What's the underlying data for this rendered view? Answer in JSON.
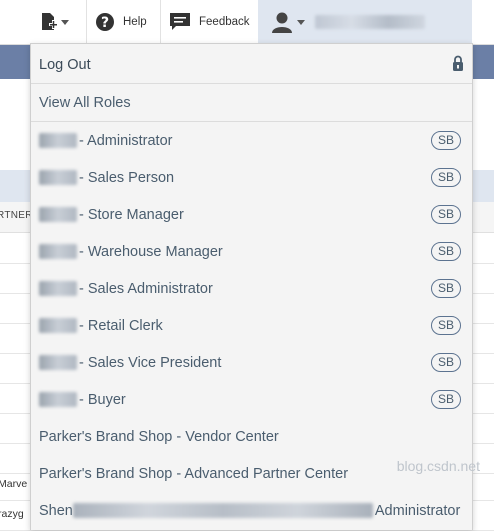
{
  "toolbar": {
    "help_label": "Help",
    "feedback_label": "Feedback",
    "user_name": ""
  },
  "background": {
    "column_header": "RTNER",
    "rows": [
      "",
      "",
      "",
      "",
      "",
      "",
      "",
      "",
      "Marve",
      "razyg"
    ]
  },
  "menu": {
    "logout": "Log Out",
    "view_all_roles": "View All Roles",
    "roles": [
      {
        "name": "- Administrator",
        "badge": "SB"
      },
      {
        "name": "- Sales Person",
        "badge": "SB"
      },
      {
        "name": "- Store Manager",
        "badge": "SB"
      },
      {
        "name": "- Warehouse Manager",
        "badge": "SB"
      },
      {
        "name": "- Sales Administrator",
        "badge": "SB"
      },
      {
        "name": "- Retail Clerk",
        "badge": "SB"
      },
      {
        "name": "- Sales Vice President",
        "badge": "SB"
      },
      {
        "name": "- Buyer",
        "badge": "SB"
      }
    ],
    "vendor_center": "Parker's Brand Shop - Vendor Center",
    "partner_center": "Parker's Brand Shop - Advanced Partner Center",
    "last_prefix": "Shen",
    "last_suffix": "Administrator"
  },
  "watermark": "blog.csdn.net",
  "icons": {
    "add": "add-document-icon",
    "help": "question-circle-icon",
    "feedback": "speech-bubble-icon",
    "user": "user-avatar-icon",
    "lock": "lock-icon"
  }
}
